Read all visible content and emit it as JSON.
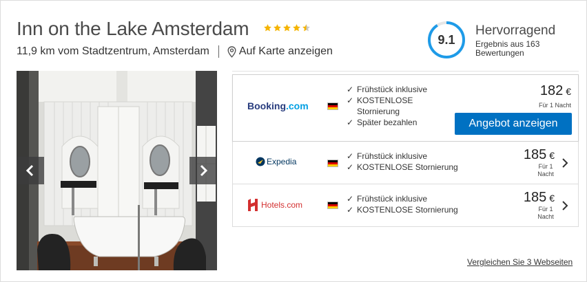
{
  "hotel": {
    "name": "Inn on the Lake Amsterdam",
    "stars": 4.5,
    "distance": "11,9 km vom Stadtzentrum, Amsterdam",
    "map_link": "Auf Karte anzeigen",
    "map_icon": "map-pin-icon"
  },
  "rating": {
    "score": "9.1",
    "score_fraction": 0.91,
    "label": "Hervorragend",
    "sub": "Ergebnis aus 163 Bewertungen",
    "ring_color": "#1e9be8"
  },
  "gallery": {
    "prev_icon": "chevron-left-icon",
    "next_icon": "chevron-right-icon"
  },
  "offers": [
    {
      "provider": "Booking.com",
      "provider_a": "Booking",
      "provider_b": ".com",
      "perks": [
        "Frühstück inklusive",
        "KOSTENLOSE Stornierung",
        "Später bezahlen"
      ],
      "price": "182",
      "currency": "€",
      "per_night": "Für 1 Nacht",
      "cta": "Angebot anzeigen"
    },
    {
      "provider": "Expedia",
      "perks": [
        "Frühstück inklusive",
        "KOSTENLOSE Stornierung"
      ],
      "price": "185",
      "currency": "€",
      "per_night": "Für 1 Nacht"
    },
    {
      "provider": "Hotels.com",
      "perks": [
        "Frühstück inklusive",
        "KOSTENLOSE Stornierung"
      ],
      "price": "185",
      "currency": "€",
      "per_night": "Für 1 Nacht"
    }
  ],
  "compare_link": "Vergleichen Sie 3 Webseiten",
  "colors": {
    "cta_bg": "#0071c2",
    "booking_blue": "#273b7d",
    "booking_light": "#009fe3",
    "expedia_blue": "#00355f",
    "expedia_yellow": "#ffc72c",
    "hotels_red": "#d32f2f",
    "star_gold": "#f5b400"
  },
  "flag_country": "Deutschland"
}
